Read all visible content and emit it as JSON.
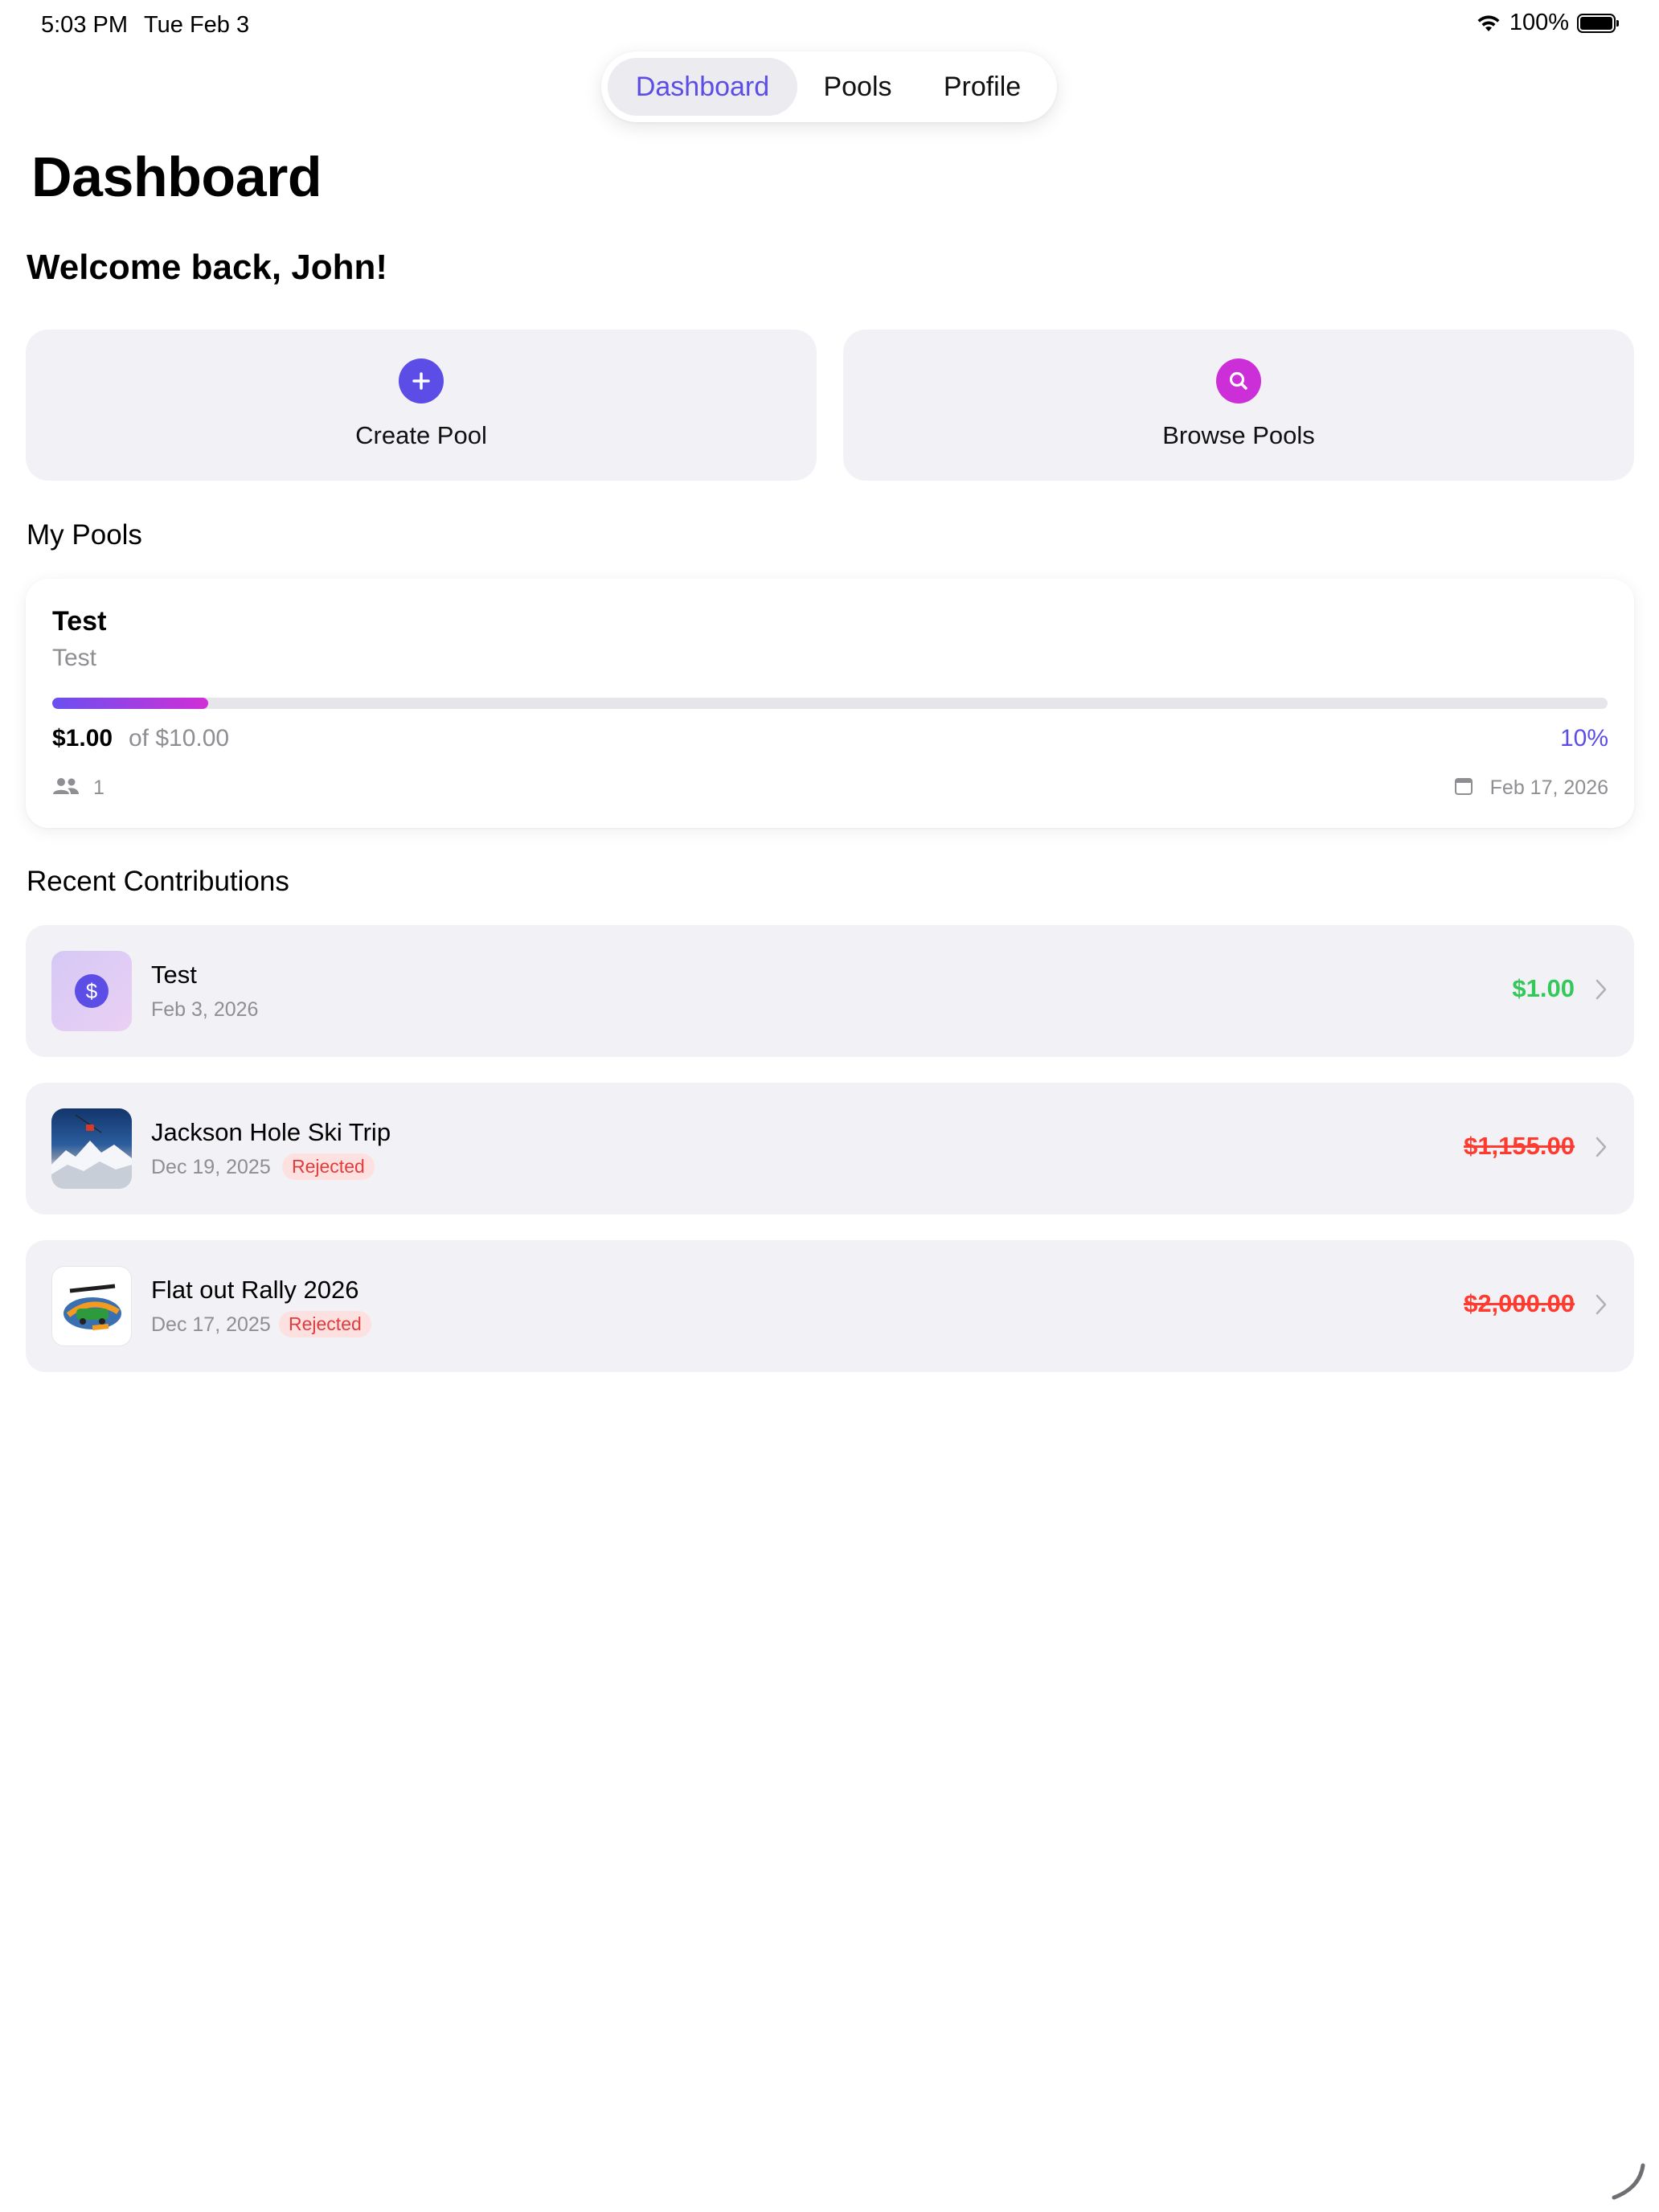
{
  "status_bar": {
    "time": "5:03 PM",
    "date": "Tue Feb 3",
    "battery": "100%"
  },
  "nav": {
    "tabs": [
      "Dashboard",
      "Pools",
      "Profile"
    ],
    "active": "Dashboard"
  },
  "page_title": "Dashboard",
  "welcome": "Welcome back, John!",
  "actions": {
    "create": {
      "label": "Create Pool",
      "icon": "plus-icon"
    },
    "browse": {
      "label": "Browse Pools",
      "icon": "search-icon"
    }
  },
  "my_pools": {
    "title": "My Pools",
    "pools": [
      {
        "name": "Test",
        "description": "Test",
        "raised": "$1.00",
        "goal": "of $10.00",
        "percent": "10%",
        "progress": 0.1,
        "members": "1",
        "date": "Feb 17, 2026"
      }
    ]
  },
  "recent": {
    "title": "Recent Contributions",
    "items": [
      {
        "title": "Test",
        "date": "Feb 3, 2026",
        "amount": "$1.00",
        "status": ""
      },
      {
        "title": "Jackson Hole Ski Trip",
        "date": "Dec 19, 2025",
        "amount": "$1,155.00",
        "status": "Rejected"
      },
      {
        "title": "Flat out Rally 2026",
        "date": "Dec 17, 2025",
        "amount": "$2,000.00",
        "status": "Rejected"
      }
    ]
  },
  "colors": {
    "accent": "#5b4de6",
    "magenta": "#cc2fd8",
    "success": "#34c759",
    "danger": "#ff3b30",
    "card": "#f2f2f6"
  }
}
